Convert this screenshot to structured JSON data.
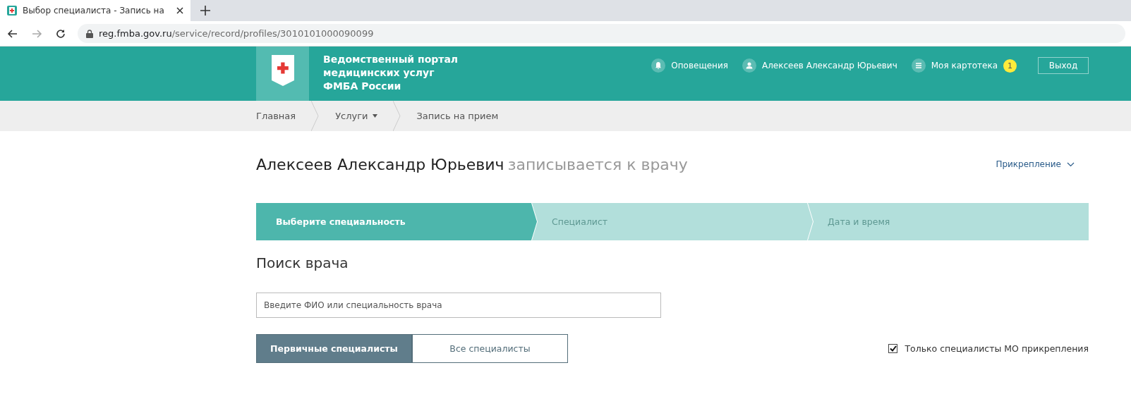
{
  "browser": {
    "tab_title": "Выбор специалиста - Запись на",
    "url_host": "reg.fmba.gov.ru",
    "url_path": "/service/record/profiles/3010101000090099"
  },
  "header": {
    "portal_title": [
      "Ведомственный портал",
      "медицинских услуг",
      "ФМБА России"
    ],
    "nav": [
      {
        "kind": "bell",
        "label": "Оповещения"
      },
      {
        "kind": "user",
        "label": "Алексеев Александр Юрьевич"
      },
      {
        "kind": "list",
        "label": "Моя картотека",
        "badge": "1"
      }
    ],
    "logout": "Выход"
  },
  "breadcrumbs": [
    {
      "label": "Главная",
      "dropdown": false
    },
    {
      "label": "Услуги",
      "dropdown": true
    },
    {
      "label": "Запись на прием",
      "dropdown": false
    }
  ],
  "page": {
    "patient": "Алексеев Александр Юрьевич",
    "subtitle": "записывается к врачу",
    "attachment_link": "Прикрепление"
  },
  "steps": [
    {
      "label": "Выберите специальность",
      "selected": true
    },
    {
      "label": "Специалист",
      "selected": false
    },
    {
      "label": "Дата и время",
      "selected": false
    }
  ],
  "search": {
    "heading": "Поиск врача",
    "placeholder": "Введите ФИО или специальность врача"
  },
  "filters": [
    {
      "label": "Первичные специалисты",
      "selected": true
    },
    {
      "label": "Все специалисты",
      "selected": false
    }
  ],
  "only_attached": {
    "label": "Только специалисты МО прикрепления",
    "checked": true
  }
}
